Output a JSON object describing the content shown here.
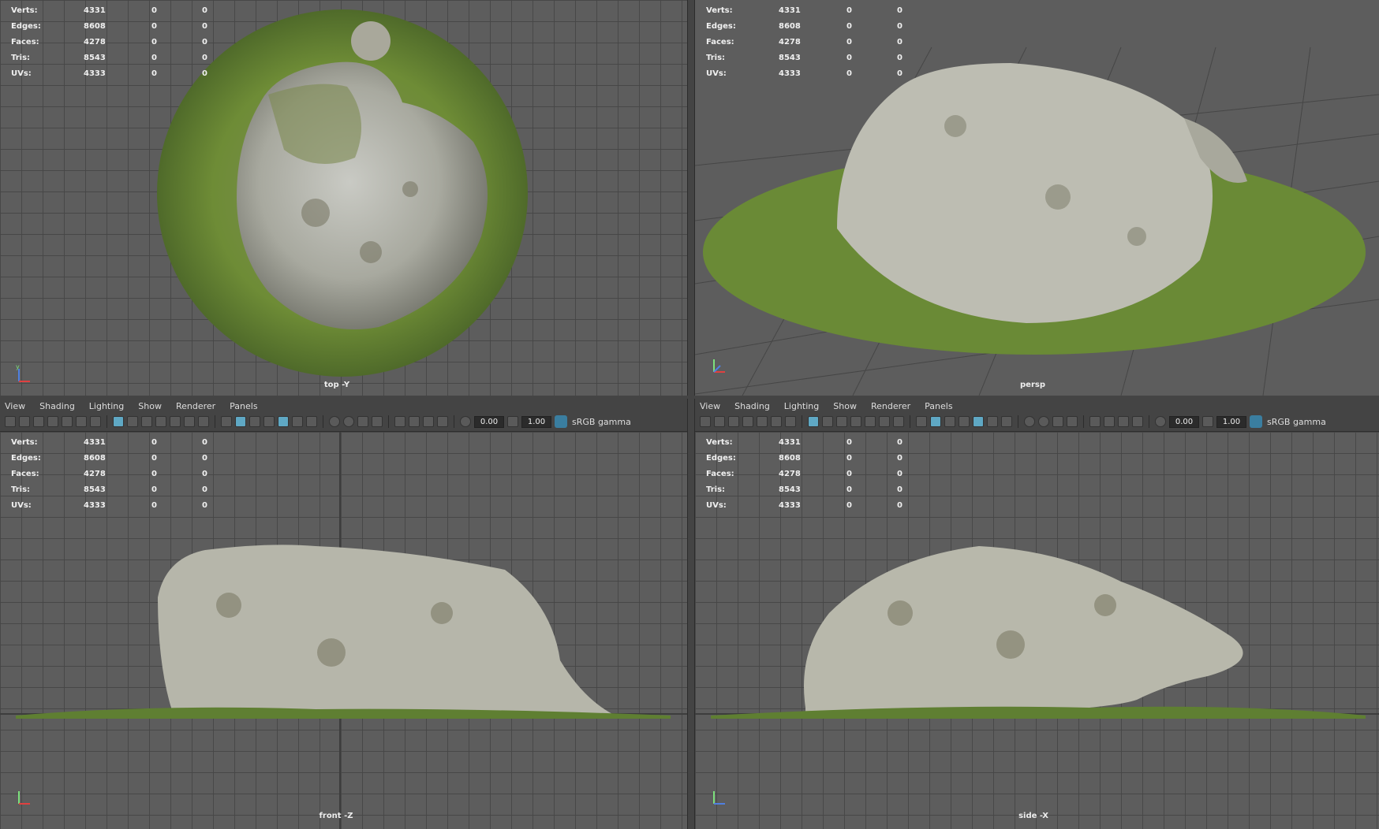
{
  "stats": {
    "rows": [
      {
        "label": "Verts:",
        "v1": "4331",
        "v2": "0",
        "v3": "0"
      },
      {
        "label": "Edges:",
        "v1": "8608",
        "v2": "0",
        "v3": "0"
      },
      {
        "label": "Faces:",
        "v1": "4278",
        "v2": "0",
        "v3": "0"
      },
      {
        "label": "Tris:",
        "v1": "8543",
        "v2": "0",
        "v3": "0"
      },
      {
        "label": "UVs:",
        "v1": "4333",
        "v2": "0",
        "v3": "0"
      }
    ]
  },
  "viewports": {
    "top": {
      "camera": "top -Y"
    },
    "persp": {
      "camera": "persp"
    },
    "front": {
      "camera": "front -Z"
    },
    "side": {
      "camera": "side -X"
    }
  },
  "panel_menu": [
    "View",
    "Shading",
    "Lighting",
    "Show",
    "Renderer",
    "Panels"
  ],
  "toolbar": {
    "exposure": "0.00",
    "gamma": "1.00",
    "color_space": "sRGB gamma"
  },
  "colors": {
    "viewport_bg": "#5d5d5d",
    "grid_line": "#464646",
    "accent": "#5fa8c4",
    "rock": "#b8b8ac",
    "moss": "#6b8a3a"
  }
}
